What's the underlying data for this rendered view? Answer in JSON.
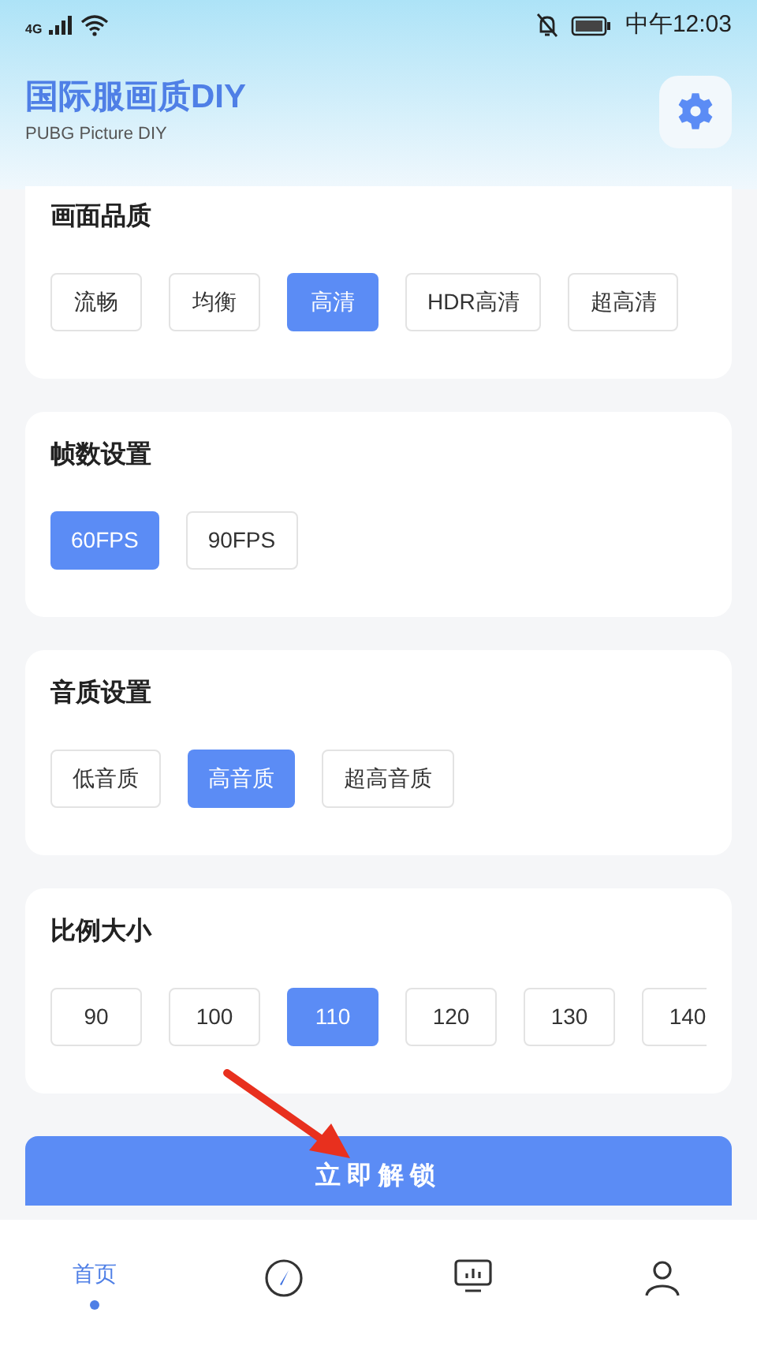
{
  "status_bar": {
    "network": "4G",
    "time": "中午12:03"
  },
  "header": {
    "title": "国际服画质DIY",
    "subtitle": "PUBG Picture DIY"
  },
  "sections": [
    {
      "title": "画面品质",
      "options": [
        {
          "label": "流畅",
          "selected": false
        },
        {
          "label": "均衡",
          "selected": false
        },
        {
          "label": "高清",
          "selected": true
        },
        {
          "label": "HDR高清",
          "selected": false
        },
        {
          "label": "超高清",
          "selected": false
        }
      ]
    },
    {
      "title": "帧数设置",
      "options": [
        {
          "label": "60FPS",
          "selected": true
        },
        {
          "label": "90FPS",
          "selected": false
        }
      ]
    },
    {
      "title": "音质设置",
      "options": [
        {
          "label": "低音质",
          "selected": false
        },
        {
          "label": "高音质",
          "selected": true
        },
        {
          "label": "超高音质",
          "selected": false
        }
      ]
    },
    {
      "title": "比例大小",
      "options": [
        {
          "label": "90",
          "selected": false
        },
        {
          "label": "100",
          "selected": false
        },
        {
          "label": "110",
          "selected": true
        },
        {
          "label": "120",
          "selected": false
        },
        {
          "label": "130",
          "selected": false
        },
        {
          "label": "140",
          "selected": false
        }
      ]
    }
  ],
  "unlock_button": "立即解锁",
  "tab_bar": [
    {
      "kind": "text",
      "label": "首页",
      "selected": true
    },
    {
      "kind": "compass",
      "selected": false
    },
    {
      "kind": "chart",
      "selected": false
    },
    {
      "kind": "user",
      "selected": false
    }
  ]
}
